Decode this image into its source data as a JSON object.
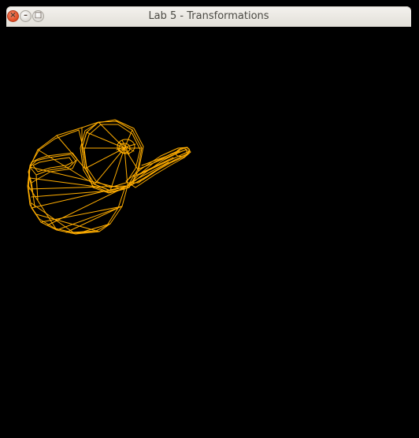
{
  "window": {
    "title": "Lab 5 - Transformations",
    "buttons": {
      "close_icon": "close-icon",
      "minimize_icon": "minimize-icon",
      "maximize_icon": "maximize-icon"
    }
  },
  "viewport": {
    "background": "#000000",
    "model": "teapot",
    "render_mode": "wireframe",
    "wire_color": "#ffad00"
  }
}
